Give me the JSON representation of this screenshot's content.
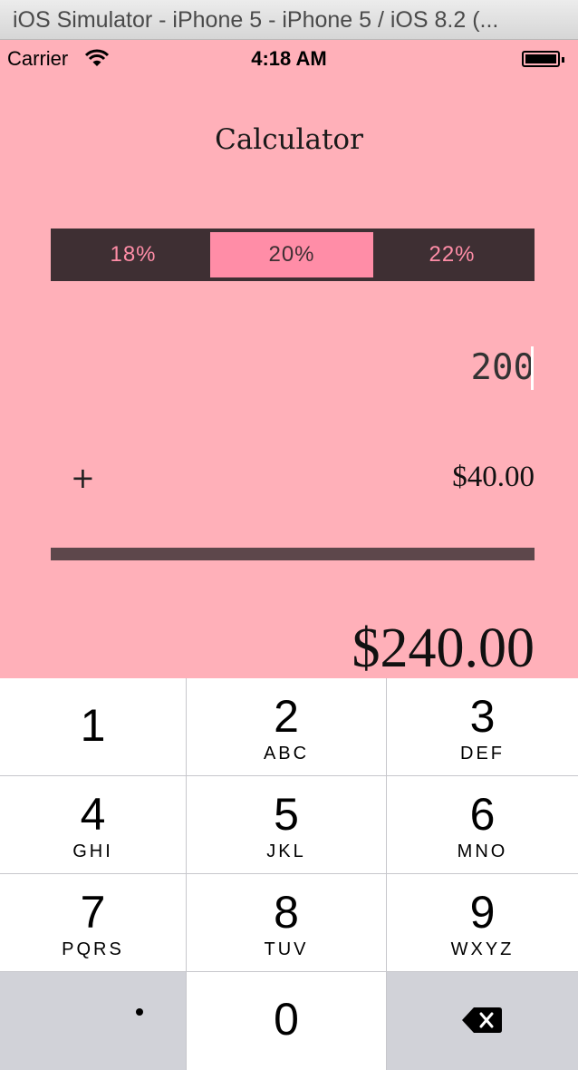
{
  "window": {
    "title": "iOS Simulator - iPhone 5 - iPhone 5 / iOS 8.2 (..."
  },
  "status_bar": {
    "carrier": "Carrier",
    "time": "4:18 AM"
  },
  "header": {
    "title": "Calculator"
  },
  "tip_selector": {
    "options": [
      "18%",
      "20%",
      "22%"
    ],
    "selected": "20%"
  },
  "bill": {
    "value": "200"
  },
  "tip_row": {
    "operator": "+",
    "amount": "$40.00"
  },
  "total": {
    "amount": "$240.00"
  },
  "keypad": {
    "keys": [
      {
        "digit": "1",
        "letters": ""
      },
      {
        "digit": "2",
        "letters": "ABC"
      },
      {
        "digit": "3",
        "letters": "DEF"
      },
      {
        "digit": "4",
        "letters": "GHI"
      },
      {
        "digit": "5",
        "letters": "JKL"
      },
      {
        "digit": "6",
        "letters": "MNO"
      },
      {
        "digit": "7",
        "letters": "PQRS"
      },
      {
        "digit": "8",
        "letters": "TUV"
      },
      {
        "digit": "9",
        "letters": "WXYZ"
      }
    ],
    "decimal": ".",
    "zero": "0"
  },
  "colors": {
    "background": "#ffb0b9",
    "segment_bg": "#3e2f33",
    "segment_accent": "#ff8da7",
    "divider": "#5d474b"
  },
  "icons": [
    "wifi-icon",
    "battery-icon",
    "backspace-icon"
  ]
}
